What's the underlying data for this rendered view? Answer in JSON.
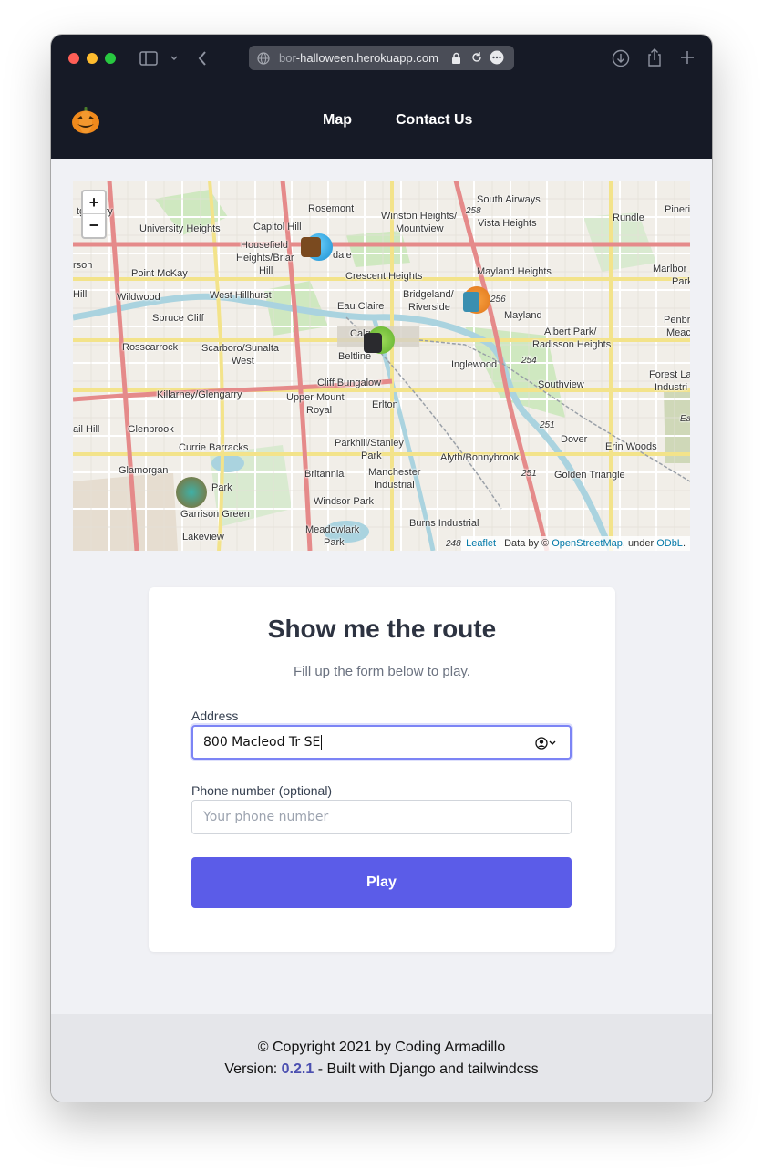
{
  "browser": {
    "url_prefix": "bor",
    "url_main": "-halloween.herokuapp.com"
  },
  "nav": {
    "logo_alt": "pumpkin-logo",
    "links": [
      "Map",
      "Contact Us"
    ]
  },
  "map": {
    "zoom_in": "+",
    "zoom_out": "−",
    "labels": [
      "tgomery",
      "University Heights",
      "Capitol Hill",
      "Rosemont",
      "Winston Heights/",
      "Mountview",
      "South Airways",
      "Vista Heights",
      "Rundle",
      "Pineri",
      "Housefield",
      "Heights/Briar",
      "Hill",
      "dale",
      "rson",
      "Point McKay",
      "Crescent Heights",
      "Mayland Heights",
      "Marlbor",
      "Park",
      "Hill",
      "Wildwood",
      "West Hillhurst",
      "Bridgeland/",
      "Riverside",
      "Eau Claire",
      "Mayland",
      "Spruce Cliff",
      "Penbr",
      "Meac",
      "Albert Park/",
      "Radisson Heights",
      "Rosscarrock",
      "Scarboro/Sunalta",
      "West",
      "Calg",
      "Beltline",
      "Inglewood",
      "Forest La",
      "Industri",
      "Southview",
      "Killarney/Glengarry",
      "Cliff Bungalow",
      "Upper Mount",
      "Royal",
      "Erlton",
      "Glenbrook",
      "Currie Barracks",
      "Parkhill/Stanley",
      "Park",
      "Dover",
      "Erin Woods",
      "Alyth/Bonnybrook",
      "Glamorgan",
      "Britannia",
      "Manchester",
      "Industrial",
      "Golden Triangle",
      "Park",
      "Garrison Green",
      "Windsor Park",
      "Burns Industrial",
      "Meadowlark",
      "Park",
      "Lakeview",
      "ail Hill",
      "258",
      "256",
      "254",
      "251",
      "251",
      "248",
      "Ea"
    ],
    "attribution": {
      "leaflet": "Leaflet",
      "data_by": " | Data by © ",
      "osm": "OpenStreetMap",
      "under": ", under ",
      "odbl": "ODbL",
      "end": "."
    }
  },
  "form": {
    "title": "Show me the route",
    "subtitle": "Fill up the form below to play.",
    "address_label": "Address",
    "address_value": "800 Macleod Tr SE",
    "phone_label": "Phone number (optional)",
    "phone_placeholder": "Your phone number",
    "submit_label": "Play"
  },
  "footer": {
    "copyright": "© Copyright 2021 by Coding Armadillo",
    "version_prefix": "Version: ",
    "version": "0.2.1",
    "version_suffix": " - Built with Django and tailwindcss"
  },
  "colors": {
    "navbar": "#161a26",
    "accent": "#5b5ce8",
    "page_bg": "#f0f1f5",
    "footer_bg": "#e5e6ea"
  }
}
